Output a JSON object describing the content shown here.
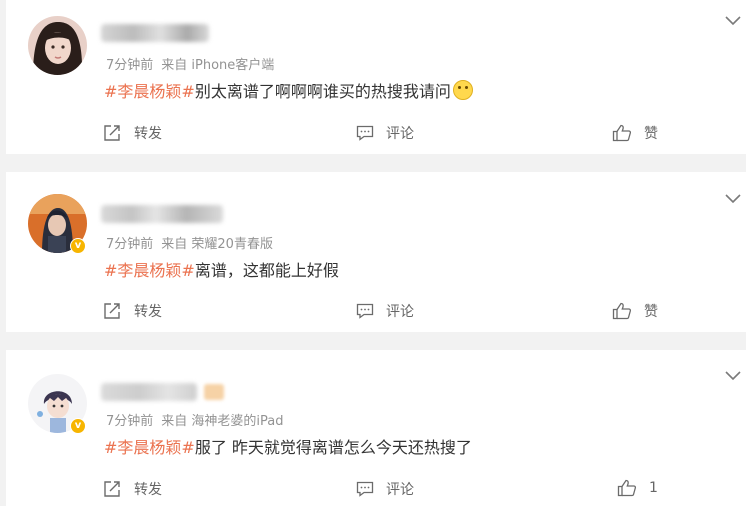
{
  "posts": [
    {
      "meta": {
        "time": "7分钟前",
        "source": "来自 iPhone客户端"
      },
      "hashtag": "#李晨杨颖#",
      "text": "别太离谱了啊啊啊谁买的热搜我请问",
      "emoji": "smile-emoji-icon",
      "actions": {
        "repost": "转发",
        "comment": "评论",
        "like": "赞"
      },
      "verified": false
    },
    {
      "meta": {
        "time": "7分钟前",
        "source": "来自 荣耀20青春版"
      },
      "hashtag": "#李晨杨颖#",
      "text": "离谱，这都能上好假",
      "actions": {
        "repost": "转发",
        "comment": "评论",
        "like": "赞"
      },
      "verified": true
    },
    {
      "meta": {
        "time": "7分钟前",
        "source": "来自 海神老婆的iPad"
      },
      "hashtag": "#李晨杨颖#",
      "text": "服了 昨天就觉得离谱怎么今天还热搜了",
      "actions": {
        "repost": "转发",
        "comment": "评论",
        "like": "1"
      },
      "verified": true
    }
  ],
  "colors": {
    "hashtag": "#eb7350",
    "meta": "#939393",
    "background": "#f2f2f2",
    "verified": "#f7b500"
  },
  "icons": [
    "repost-icon",
    "comment-icon",
    "like-icon",
    "chevron-down-icon"
  ]
}
